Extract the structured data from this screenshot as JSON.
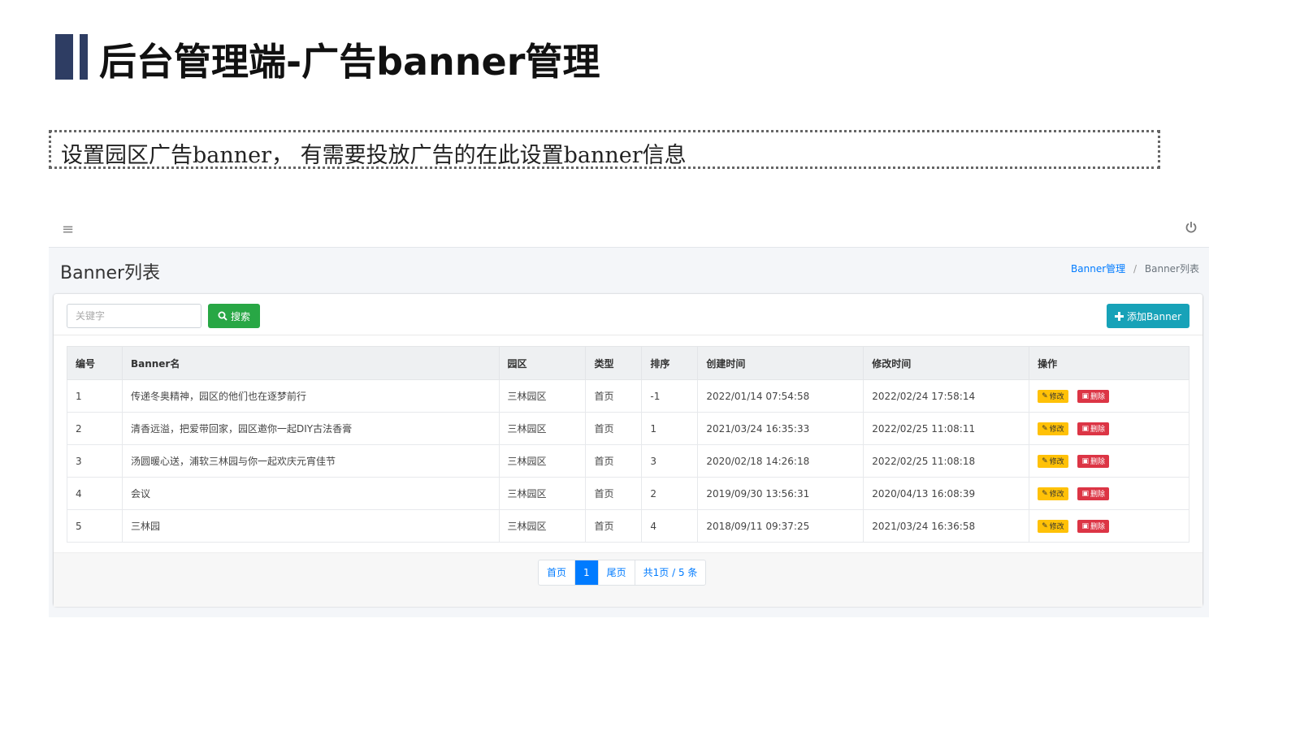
{
  "slide": {
    "title": "后台管理端-广告banner管理",
    "description": "设置园区广告banner， 有需要投放广告的在此设置banner信息"
  },
  "app": {
    "nav": {
      "menu_icon": "hamburger-icon",
      "power_icon": "power-icon"
    },
    "page_title": "Banner列表",
    "breadcrumb": {
      "parent": "Banner管理",
      "separator": "/",
      "current": "Banner列表"
    },
    "search": {
      "placeholder": "关键字",
      "button_label": "搜索"
    },
    "add_button_label": "添加Banner",
    "table": {
      "headers": [
        "编号",
        "Banner名",
        "园区",
        "类型",
        "排序",
        "创建时间",
        "修改时间",
        "操作"
      ],
      "edit_label": "修改",
      "delete_label": "删除",
      "rows": [
        {
          "id": "1",
          "name": "传递冬奥精神，园区的他们也在逐梦前行",
          "park": "三林园区",
          "type": "首页",
          "order": "-1",
          "created": "2022/01/14 07:54:58",
          "modified": "2022/02/24 17:58:14"
        },
        {
          "id": "2",
          "name": "清香远溢，把爱带回家，园区邀你一起DIY古法香膏",
          "park": "三林园区",
          "type": "首页",
          "order": "1",
          "created": "2021/03/24 16:35:33",
          "modified": "2022/02/25 11:08:11"
        },
        {
          "id": "3",
          "name": "汤圆暖心送，浦软三林园与你一起欢庆元宵佳节",
          "park": "三林园区",
          "type": "首页",
          "order": "3",
          "created": "2020/02/18 14:26:18",
          "modified": "2022/02/25 11:08:18"
        },
        {
          "id": "4",
          "name": "会议",
          "park": "三林园区",
          "type": "首页",
          "order": "2",
          "created": "2019/09/30 13:56:31",
          "modified": "2020/04/13 16:08:39"
        },
        {
          "id": "5",
          "name": "三林园",
          "park": "三林园区",
          "type": "首页",
          "order": "4",
          "created": "2018/09/11 09:37:25",
          "modified": "2021/03/24 16:36:58"
        }
      ]
    },
    "pagination": {
      "first": "首页",
      "current": "1",
      "last": "尾页",
      "summary": "共1页 / 5 条"
    }
  },
  "colors": {
    "title_bar": "#2e3d63",
    "search_button": "#28a745",
    "add_button": "#17a2b8",
    "edit_button": "#ffc107",
    "delete_button": "#dc3545",
    "link": "#007bff"
  }
}
